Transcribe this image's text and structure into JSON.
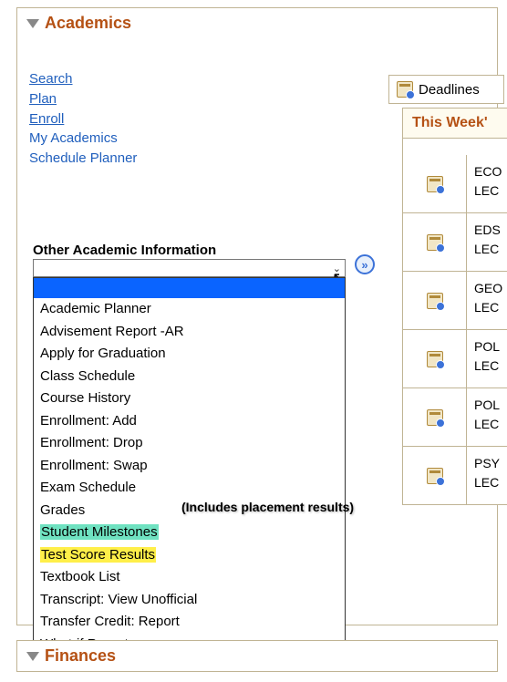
{
  "sections": {
    "academics": "Academics",
    "finances": "Finances"
  },
  "links": {
    "search": "Search",
    "plan": "Plan",
    "enroll": "Enroll",
    "my_academics": "My Academics",
    "schedule_planner": "Schedule Planner"
  },
  "deadlines_label": "Deadlines",
  "week_header": "This Week'",
  "week_rows": [
    {
      "line1": "ECO",
      "line2": "LEC"
    },
    {
      "line1": "EDS",
      "line2": "LEC"
    },
    {
      "line1": "GEO",
      "line2": "LEC"
    },
    {
      "line1": "POL",
      "line2": "LEC"
    },
    {
      "line1": "POL",
      "line2": "LEC"
    },
    {
      "line1": "PSY",
      "line2": "LEC"
    }
  ],
  "other_info": {
    "label": "Other Academic Information",
    "go_glyph": "»",
    "chev": "⌄",
    "options": [
      "Academic Planner",
      "Advisement Report -AR",
      "Apply for Graduation",
      "Class Schedule",
      "Course History",
      "Enrollment: Add",
      "Enrollment: Drop",
      "Enrollment: Swap",
      "Exam Schedule",
      "Grades",
      "Student Milestones",
      "Test Score Results",
      "Textbook List",
      "Transcript: View Unofficial",
      "Transfer Credit: Report",
      "What-if Report"
    ],
    "highlight_green_index": 10,
    "highlight_yellow_index": 11
  },
  "annotation": "(Includes placement results)",
  "cursor_glyph": "↖"
}
